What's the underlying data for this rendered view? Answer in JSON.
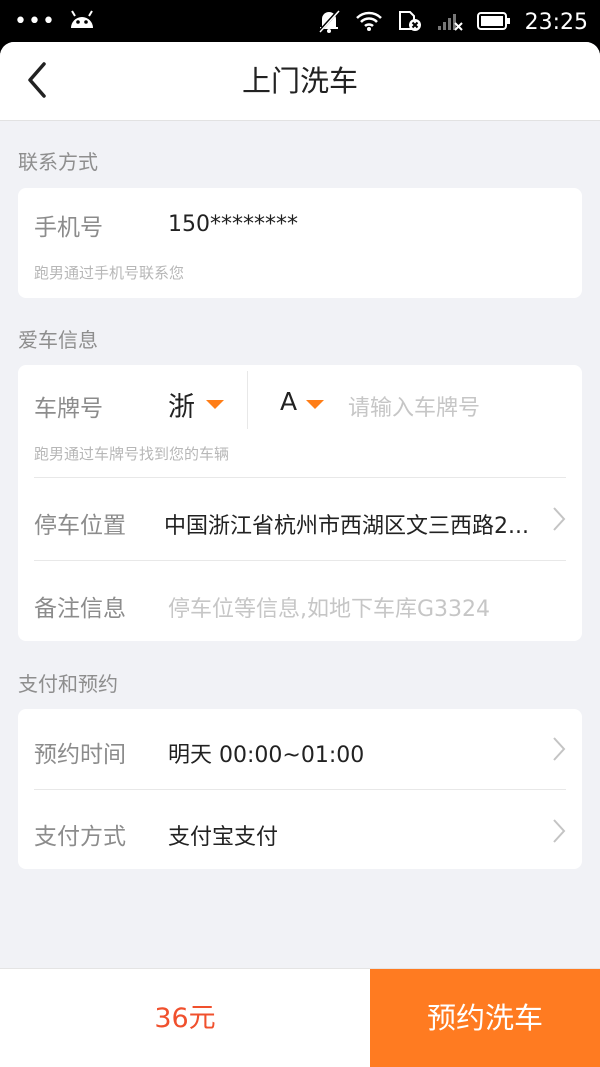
{
  "status_bar": {
    "dots": "•••",
    "time": "23:25",
    "icons": [
      "android-icon",
      "silent-bell-icon",
      "wifi-icon",
      "sim-disabled-icon",
      "signal-icon",
      "battery-icon"
    ]
  },
  "header": {
    "title": "上门洗车",
    "back_icon": "back-chevron-icon"
  },
  "contact": {
    "section_label": "联系方式",
    "phone_label": "手机号",
    "phone_value": "150********",
    "phone_hint": "跑男通过手机号联系您"
  },
  "car": {
    "section_label": "爱车信息",
    "plate_label": "车牌号",
    "province": "浙",
    "letter": "A",
    "plate_placeholder": "请输入车牌号",
    "plate_hint": "跑男通过车牌号找到您的车辆",
    "parking_label": "停车位置",
    "parking_value": "中国浙江省杭州市西湖区文三西路2...",
    "note_label": "备注信息",
    "note_placeholder": "停车位等信息,如地下车库G3324"
  },
  "payment": {
    "section_label": "支付和预约",
    "time_label": "预约时间",
    "time_value": "明天 00:00~01:00",
    "method_label": "支付方式",
    "method_value": "支付宝支付"
  },
  "bottom": {
    "price": "36元",
    "book_label": "预约洗车"
  },
  "colors": {
    "accent": "#ff7b21",
    "price": "#f0502d",
    "background": "#f1f2f6"
  }
}
